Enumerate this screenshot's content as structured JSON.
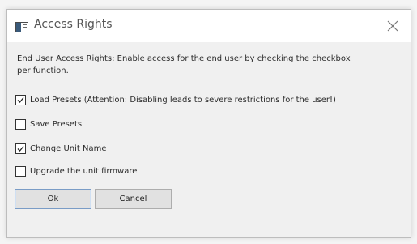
{
  "dialog": {
    "title": "Access Rights",
    "icons": {
      "app": "app-window-icon",
      "close": "close-icon"
    },
    "description": "End User Access Rights: Enable access for the end user by checking the checkbox per function.",
    "options": [
      {
        "label": "Load Presets (Attention: Disabling leads to severe restrictions for the user!)",
        "checked": true
      },
      {
        "label": "Save Presets",
        "checked": false
      },
      {
        "label": "Change Unit Name",
        "checked": true
      },
      {
        "label": "Upgrade the unit firmware",
        "checked": false
      }
    ],
    "buttons": {
      "ok": "Ok",
      "cancel": "Cancel"
    },
    "colors": {
      "accent": "#7a9cc6",
      "window_bg": "#f0f0f0",
      "titlebar_bg": "#ffffff"
    }
  }
}
